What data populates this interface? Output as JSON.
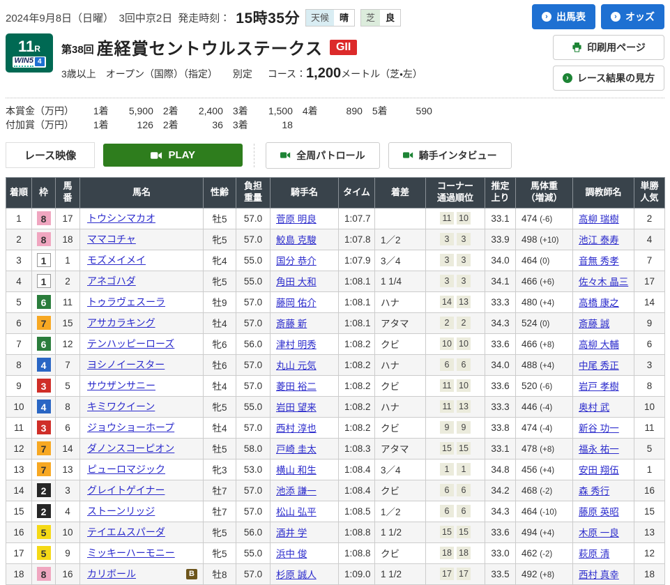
{
  "meta": {
    "date_line": "2024年9月8日（日曜）　3回中京2日",
    "start_label": "発走時刻：",
    "start_time": "15時35分",
    "weather_label": "天候",
    "weather_value": "晴",
    "turf_label": "芝",
    "turf_value": "良"
  },
  "top_actions": {
    "entries_label": "出馬表",
    "odds_label": "オッズ",
    "print_label": "印刷用ページ",
    "guide_label": "レース結果の見方"
  },
  "race": {
    "number": "11",
    "number_suffix": "R",
    "win5_label": "WIN5",
    "win5_number": "4",
    "edition": "第38回",
    "title": "産経賞セントウルステークス",
    "grade": "GII",
    "conditions": "3歳以上　オープン（国際）（指定）",
    "weight_rule": "別定",
    "course_label": "コース：",
    "course_distance": "1,200",
    "course_suffix": "メートル（芝・左）"
  },
  "prizes": {
    "main_label": "本賞金（万円）",
    "main": [
      {
        "place": "1着",
        "amount": "5,900"
      },
      {
        "place": "2着",
        "amount": "2,400"
      },
      {
        "place": "3着",
        "amount": "1,500"
      },
      {
        "place": "4着",
        "amount": "890"
      },
      {
        "place": "5着",
        "amount": "590"
      }
    ],
    "added_label": "付加賞（万円）",
    "added": [
      {
        "place": "1着",
        "amount": "126"
      },
      {
        "place": "2着",
        "amount": "36"
      },
      {
        "place": "3着",
        "amount": "18"
      }
    ]
  },
  "video": {
    "section_label": "レース映像",
    "play_label": "PLAY",
    "patrol_label": "全周パトロール",
    "interview_label": "騎手インタビュー"
  },
  "colors": {
    "accent_blue": "#1e70d2",
    "accent_green": "#1d8435",
    "play_green": "#2e7d1d",
    "race_badge_green": "#006953",
    "grade_red": "#dc2a2a",
    "header_bg": "#39434b",
    "b_badge_brown": "#6d551c"
  },
  "frame_colors": {
    "1": {
      "bg": "#ffffff",
      "fg": "#333333",
      "border": "#999999"
    },
    "2": {
      "bg": "#262626",
      "fg": "#ffffff",
      "border": "#262626"
    },
    "3": {
      "bg": "#cf2e28",
      "fg": "#ffffff",
      "border": "#cf2e28"
    },
    "4": {
      "bg": "#2a66c4",
      "fg": "#ffffff",
      "border": "#2a66c4"
    },
    "5": {
      "bg": "#f5d916",
      "fg": "#333333",
      "border": "#f5d916"
    },
    "6": {
      "bg": "#2b7d3c",
      "fg": "#ffffff",
      "border": "#2b7d3c"
    },
    "7": {
      "bg": "#f7a823",
      "fg": "#333333",
      "border": "#f7a823"
    },
    "8": {
      "bg": "#f0a6c0",
      "fg": "#333333",
      "border": "#f0a6c0"
    }
  },
  "table": {
    "headers": [
      "着順",
      "枠",
      "馬\n番",
      "馬名",
      "性齢",
      "負担\n重量",
      "騎手名",
      "タイム",
      "着差",
      "コーナー\n通過順位",
      "推定\n上り",
      "馬体重\n（増減）",
      "調教師名",
      "単勝\n人気"
    ],
    "rows": [
      {
        "pos": "1",
        "frame": "8",
        "num": "17",
        "name": "トウシンマカオ",
        "blinker": "",
        "sexage": "牡5",
        "weight": "57.0",
        "jockey": "菅原 明良",
        "time": "1:07.7",
        "margin": "",
        "corners": [
          "11",
          "10"
        ],
        "last3f": "33.1",
        "body": "474",
        "diff": "(-6)",
        "trainer": "高柳 瑞樹",
        "pop": "2"
      },
      {
        "pos": "2",
        "frame": "8",
        "num": "18",
        "name": "ママコチャ",
        "blinker": "",
        "sexage": "牝5",
        "weight": "57.0",
        "jockey": "鮫島 克駿",
        "time": "1:07.8",
        "margin": "1／2",
        "corners": [
          "3",
          "3"
        ],
        "last3f": "33.9",
        "body": "498",
        "diff": "(+10)",
        "trainer": "池江 泰寿",
        "pop": "4"
      },
      {
        "pos": "3",
        "frame": "1",
        "num": "1",
        "name": "モズメイメイ",
        "blinker": "",
        "sexage": "牝4",
        "weight": "55.0",
        "jockey": "国分 恭介",
        "time": "1:07.9",
        "margin": "3／4",
        "corners": [
          "3",
          "3"
        ],
        "last3f": "34.0",
        "body": "464",
        "diff": "(0)",
        "trainer": "音無 秀孝",
        "pop": "7"
      },
      {
        "pos": "4",
        "frame": "1",
        "num": "2",
        "name": "アネゴハダ",
        "blinker": "",
        "sexage": "牝5",
        "weight": "55.0",
        "jockey": "角田 大和",
        "time": "1:08.1",
        "margin": "1 1/4",
        "corners": [
          "3",
          "3"
        ],
        "last3f": "34.1",
        "body": "466",
        "diff": "(+6)",
        "trainer": "佐々木 晶三",
        "pop": "17"
      },
      {
        "pos": "5",
        "frame": "6",
        "num": "11",
        "name": "トゥラヴェスーラ",
        "blinker": "",
        "sexage": "牡9",
        "weight": "57.0",
        "jockey": "藤岡 佑介",
        "time": "1:08.1",
        "margin": "ハナ",
        "corners": [
          "14",
          "13"
        ],
        "last3f": "33.3",
        "body": "480",
        "diff": "(+4)",
        "trainer": "高橋 康之",
        "pop": "14"
      },
      {
        "pos": "6",
        "frame": "7",
        "num": "15",
        "name": "アサカラキング",
        "blinker": "",
        "sexage": "牡4",
        "weight": "57.0",
        "jockey": "斎藤 新",
        "time": "1:08.1",
        "margin": "アタマ",
        "corners": [
          "2",
          "2"
        ],
        "last3f": "34.3",
        "body": "524",
        "diff": "(0)",
        "trainer": "斎藤 誠",
        "pop": "9"
      },
      {
        "pos": "7",
        "frame": "6",
        "num": "12",
        "name": "テンハッピーローズ",
        "blinker": "",
        "sexage": "牝6",
        "weight": "56.0",
        "jockey": "津村 明秀",
        "time": "1:08.2",
        "margin": "クビ",
        "corners": [
          "10",
          "10"
        ],
        "last3f": "33.6",
        "body": "466",
        "diff": "(+8)",
        "trainer": "高柳 大輔",
        "pop": "6"
      },
      {
        "pos": "8",
        "frame": "4",
        "num": "7",
        "name": "ヨシノイースター",
        "blinker": "",
        "sexage": "牡6",
        "weight": "57.0",
        "jockey": "丸山 元気",
        "time": "1:08.2",
        "margin": "ハナ",
        "corners": [
          "6",
          "6"
        ],
        "last3f": "34.0",
        "body": "488",
        "diff": "(+4)",
        "trainer": "中尾 秀正",
        "pop": "3"
      },
      {
        "pos": "9",
        "frame": "3",
        "num": "5",
        "name": "サウザンサニー",
        "blinker": "",
        "sexage": "牡4",
        "weight": "57.0",
        "jockey": "菱田 裕二",
        "time": "1:08.2",
        "margin": "クビ",
        "corners": [
          "11",
          "10"
        ],
        "last3f": "33.6",
        "body": "520",
        "diff": "(-6)",
        "trainer": "岩戸 孝樹",
        "pop": "8"
      },
      {
        "pos": "10",
        "frame": "4",
        "num": "8",
        "name": "キミワクイーン",
        "blinker": "",
        "sexage": "牝5",
        "weight": "55.0",
        "jockey": "岩田 望来",
        "time": "1:08.2",
        "margin": "ハナ",
        "corners": [
          "11",
          "13"
        ],
        "last3f": "33.3",
        "body": "446",
        "diff": "(-4)",
        "trainer": "奥村 武",
        "pop": "10"
      },
      {
        "pos": "11",
        "frame": "3",
        "num": "6",
        "name": "ジョウショーホープ",
        "blinker": "",
        "sexage": "牡4",
        "weight": "57.0",
        "jockey": "西村 淳也",
        "time": "1:08.2",
        "margin": "クビ",
        "corners": [
          "9",
          "9"
        ],
        "last3f": "33.8",
        "body": "474",
        "diff": "(-4)",
        "trainer": "新谷 功一",
        "pop": "11"
      },
      {
        "pos": "12",
        "frame": "7",
        "num": "14",
        "name": "ダノンスコーピオン",
        "blinker": "",
        "sexage": "牡5",
        "weight": "58.0",
        "jockey": "戸崎 圭太",
        "time": "1:08.3",
        "margin": "アタマ",
        "corners": [
          "15",
          "15"
        ],
        "last3f": "33.1",
        "body": "478",
        "diff": "(+8)",
        "trainer": "福永 祐一",
        "pop": "5"
      },
      {
        "pos": "13",
        "frame": "7",
        "num": "13",
        "name": "ピューロマジック",
        "blinker": "",
        "sexage": "牝3",
        "weight": "53.0",
        "jockey": "横山 和生",
        "time": "1:08.4",
        "margin": "3／4",
        "corners": [
          "1",
          "1"
        ],
        "last3f": "34.8",
        "body": "456",
        "diff": "(+4)",
        "trainer": "安田 翔伍",
        "pop": "1"
      },
      {
        "pos": "14",
        "frame": "2",
        "num": "3",
        "name": "グレイトゲイナー",
        "blinker": "",
        "sexage": "牡7",
        "weight": "57.0",
        "jockey": "池添 謙一",
        "time": "1:08.4",
        "margin": "クビ",
        "corners": [
          "6",
          "6"
        ],
        "last3f": "34.2",
        "body": "468",
        "diff": "(-2)",
        "trainer": "森 秀行",
        "pop": "16"
      },
      {
        "pos": "15",
        "frame": "2",
        "num": "4",
        "name": "ストーンリッジ",
        "blinker": "",
        "sexage": "牡7",
        "weight": "57.0",
        "jockey": "松山 弘平",
        "time": "1:08.5",
        "margin": "1／2",
        "corners": [
          "6",
          "6"
        ],
        "last3f": "34.3",
        "body": "464",
        "diff": "(-10)",
        "trainer": "藤原 英昭",
        "pop": "15"
      },
      {
        "pos": "16",
        "frame": "5",
        "num": "10",
        "name": "テイエムスパーダ",
        "blinker": "",
        "sexage": "牝5",
        "weight": "56.0",
        "jockey": "酒井 学",
        "time": "1:08.8",
        "margin": "1 1/2",
        "corners": [
          "15",
          "15"
        ],
        "last3f": "33.6",
        "body": "494",
        "diff": "(+4)",
        "trainer": "木原 一良",
        "pop": "13"
      },
      {
        "pos": "17",
        "frame": "5",
        "num": "9",
        "name": "ミッキーハーモニー",
        "blinker": "",
        "sexage": "牝5",
        "weight": "55.0",
        "jockey": "浜中 俊",
        "time": "1:08.8",
        "margin": "クビ",
        "corners": [
          "18",
          "18"
        ],
        "last3f": "33.0",
        "body": "462",
        "diff": "(-2)",
        "trainer": "萩原 清",
        "pop": "12"
      },
      {
        "pos": "18",
        "frame": "8",
        "num": "16",
        "name": "カリボール",
        "blinker": "B",
        "sexage": "牡8",
        "weight": "57.0",
        "jockey": "杉原 誠人",
        "time": "1:09.0",
        "margin": "1 1/2",
        "corners": [
          "17",
          "17"
        ],
        "last3f": "33.5",
        "body": "492",
        "diff": "(+8)",
        "trainer": "西村 真幸",
        "pop": "18"
      }
    ]
  }
}
